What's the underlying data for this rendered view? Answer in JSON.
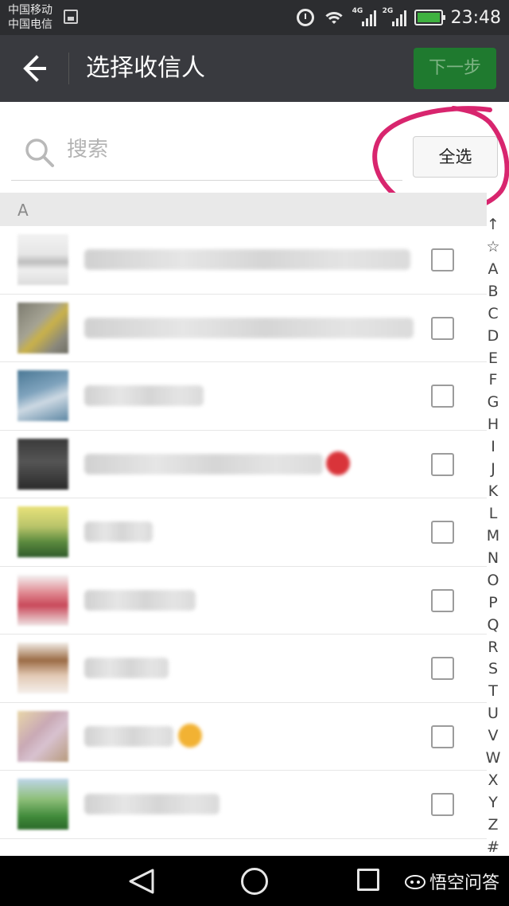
{
  "status_bar": {
    "carrier_1": "中国移动",
    "carrier_2": "中国电信",
    "network_1": "4G",
    "network_2": "2G",
    "time": "23:48",
    "icons": [
      "gallery-icon",
      "alarm-icon",
      "wifi-icon",
      "signal-icon",
      "battery-charging-icon"
    ]
  },
  "header": {
    "title": "选择收信人",
    "next_label": "下一步",
    "back_icon": "arrow-left-icon"
  },
  "search": {
    "placeholder": "搜索",
    "value": "",
    "select_all_label": "全选"
  },
  "section": {
    "label": "A"
  },
  "contacts": [
    {
      "checked": false
    },
    {
      "checked": false
    },
    {
      "checked": false
    },
    {
      "checked": false
    },
    {
      "checked": false
    },
    {
      "checked": false
    },
    {
      "checked": false
    },
    {
      "checked": false
    },
    {
      "checked": false
    }
  ],
  "index_letters": [
    "↑",
    "☆",
    "A",
    "B",
    "C",
    "D",
    "E",
    "F",
    "G",
    "H",
    "I",
    "J",
    "K",
    "L",
    "M",
    "N",
    "O",
    "P",
    "Q",
    "R",
    "S",
    "T",
    "U",
    "V",
    "W",
    "X",
    "Y",
    "Z",
    "#"
  ],
  "nav_bar": {
    "icons": [
      "triangle-back-icon",
      "circle-home-icon",
      "square-recent-icon"
    ]
  },
  "watermark": {
    "text": "悟空问答"
  },
  "colors": {
    "status_bar": "#2c2d30",
    "title_bar": "#393a3f",
    "next_button": "#1f7a2f",
    "annotation": "#d8256e"
  }
}
